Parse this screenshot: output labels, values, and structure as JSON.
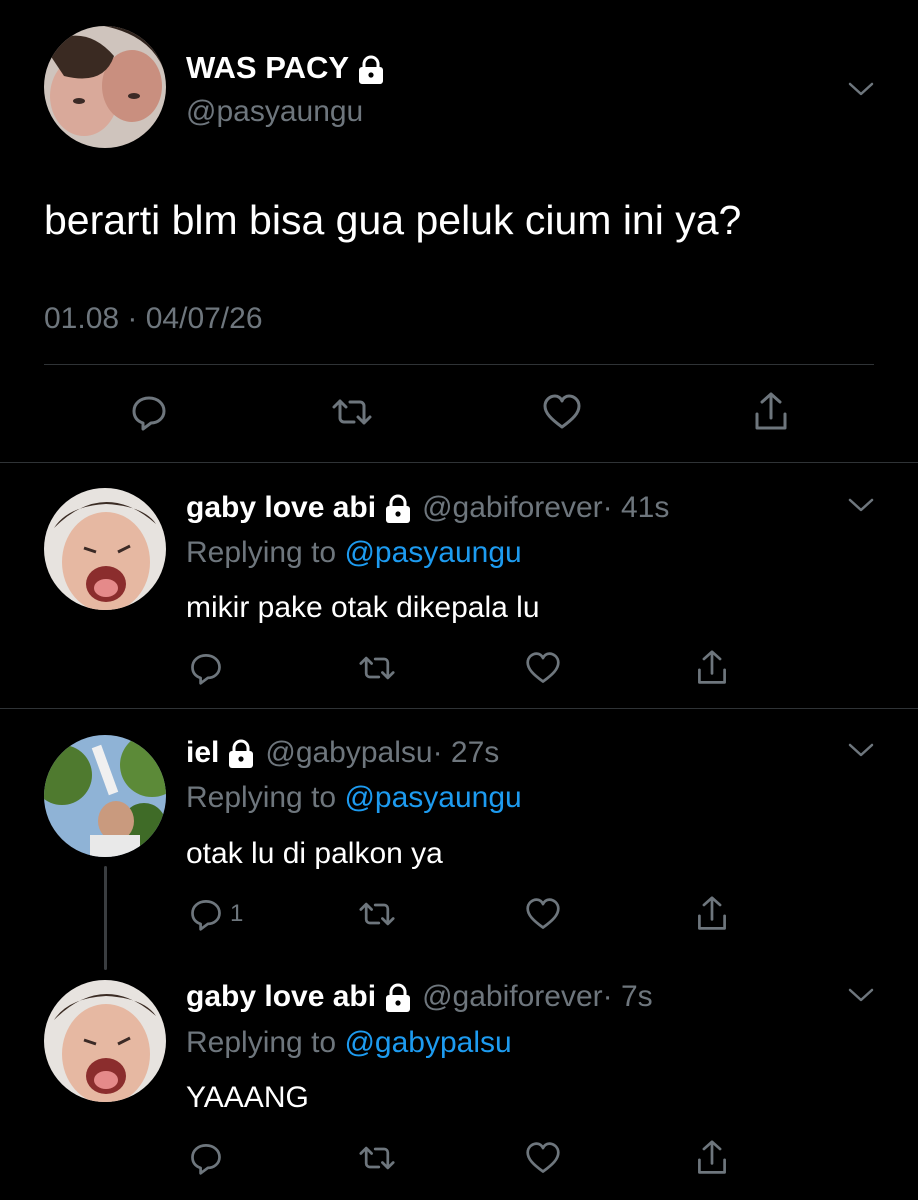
{
  "main_tweet": {
    "display_name": "WAS PACY",
    "handle": "@pasyaungu",
    "text": "berarti blm bisa gua peluk cium ini ya?",
    "timestamp": "01.08 · 04/07/26"
  },
  "replies": [
    {
      "display_name": "gaby love abi",
      "handle": "@gabiforever",
      "time": "· 41s",
      "replying_prefix": "Replying to",
      "replying_to": "@pasyaungu",
      "text": "mikir pake otak dikepala lu",
      "reply_count": ""
    },
    {
      "display_name": "iel",
      "handle": "@gabypalsu",
      "time": "· 27s",
      "replying_prefix": "Replying to",
      "replying_to": "@pasyaungu",
      "text": "otak lu di palkon ya",
      "reply_count": "1"
    },
    {
      "display_name": "gaby love abi",
      "handle": "@gabiforever",
      "time": "· 7s",
      "replying_prefix": "Replying to",
      "replying_to": "@gabypalsu",
      "text": "YAAANG",
      "reply_count": ""
    }
  ],
  "icons": {
    "lock": "lock-icon",
    "chevron": "chevron-down-icon",
    "reply": "reply-icon",
    "retweet": "retweet-icon",
    "like": "heart-icon",
    "share": "share-icon"
  },
  "colors": {
    "background": "#000000",
    "text": "#ffffff",
    "secondary": "#6e767d",
    "link": "#1d9bf0",
    "divider": "#2f3336"
  }
}
